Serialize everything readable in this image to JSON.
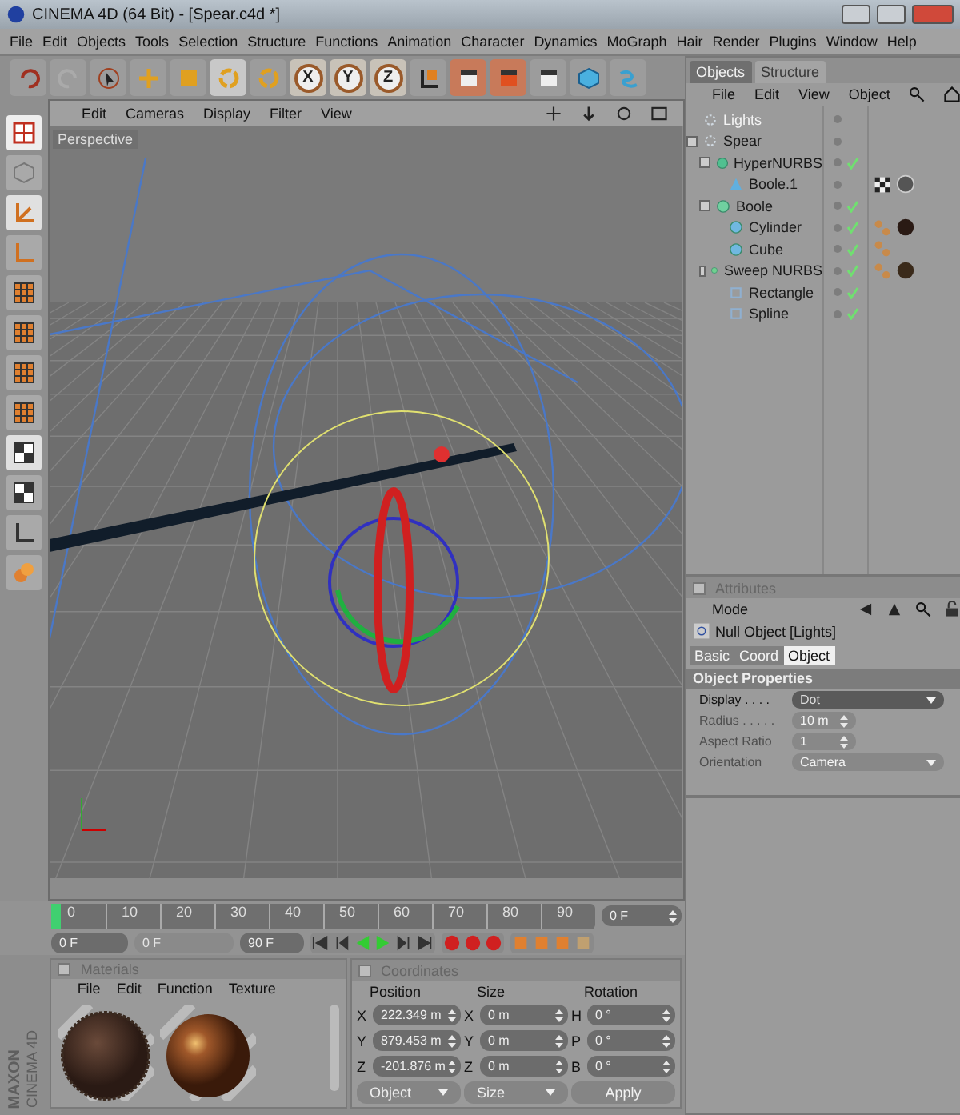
{
  "window": {
    "title": "CINEMA 4D (64 Bit) - [Spear.c4d *]"
  },
  "menu": [
    "File",
    "Edit",
    "Objects",
    "Tools",
    "Selection",
    "Structure",
    "Functions",
    "Animation",
    "Character",
    "Dynamics",
    "MoGraph",
    "Hair",
    "Render",
    "Plugins",
    "Window",
    "Help"
  ],
  "toolbar": {
    "axes": [
      "X",
      "Y",
      "Z"
    ]
  },
  "viewport": {
    "menu": [
      "Edit",
      "Cameras",
      "Display",
      "Filter",
      "View"
    ],
    "camera": "Perspective"
  },
  "timeline": {
    "ticks": [
      "0",
      "10",
      "20",
      "30",
      "40",
      "50",
      "60",
      "70",
      "80",
      "90"
    ],
    "level": 0,
    "current": "0 F",
    "start": "0 F",
    "slider": "0 F",
    "end": "90 F"
  },
  "materials": {
    "title": "Materials",
    "checked": false,
    "menu": [
      "File",
      "Edit",
      "Function",
      "Texture"
    ],
    "items": [
      {
        "kind": "rough"
      },
      {
        "kind": "glossy"
      }
    ]
  },
  "coordinates": {
    "title": "Coordinates",
    "checked": false,
    "headers": [
      "Position",
      "Size",
      "Rotation"
    ],
    "rows": [
      {
        "pos_axis": "X",
        "pos": "222.349 m",
        "size_axis": "X",
        "size": "0 m",
        "rot_axis": "H",
        "rot": "0 °"
      },
      {
        "pos_axis": "Y",
        "pos": "879.453 m",
        "size_axis": "Y",
        "size": "0 m",
        "rot_axis": "P",
        "rot": "0 °"
      },
      {
        "pos_axis": "Z",
        "pos": "-201.876 m",
        "size_axis": "Z",
        "size": "0 m",
        "rot_axis": "B",
        "rot": "0 °"
      }
    ],
    "modes": [
      "Object",
      "Size"
    ],
    "apply": "Apply"
  },
  "objects": {
    "tabs": [
      {
        "label": "Objects",
        "selected": true
      },
      {
        "label": "Structure",
        "selected": false
      }
    ],
    "menu": [
      "File",
      "Edit",
      "View",
      "Object"
    ],
    "tree": [
      {
        "name": "Lights",
        "kind": "null",
        "selected": true,
        "check": false
      },
      {
        "name": "Spear",
        "kind": "null",
        "selected": false,
        "check": false,
        "children": [
          {
            "name": "HyperNURBS",
            "kind": "nurbs",
            "selected": false,
            "check": true,
            "children": [
              {
                "name": "Boole.1",
                "kind": "cone",
                "selected": false,
                "check": false,
                "tags": [
                  {
                    "kind": "checker"
                  },
                  {
                    "kind": "gray-material"
                  }
                ]
              }
            ]
          },
          {
            "name": "Boole",
            "kind": "boole",
            "selected": false,
            "check": true,
            "children": [
              {
                "name": "Cylinder",
                "kind": "cylinder",
                "selected": false,
                "check": true,
                "tags": [
                  {
                    "kind": "phong"
                  },
                  {
                    "kind": "rough-material"
                  }
                ]
              },
              {
                "name": "Cube",
                "kind": "cube",
                "selected": false,
                "check": true,
                "tags": [
                  {
                    "kind": "phong"
                  }
                ]
              }
            ]
          },
          {
            "name": "Sweep NURBS",
            "kind": "sweep",
            "selected": false,
            "check": true,
            "tags": [
              {
                "kind": "phong"
              },
              {
                "kind": "dark-material"
              }
            ],
            "children": [
              {
                "name": "Rectangle",
                "kind": "spline",
                "selected": false,
                "check": true
              },
              {
                "name": "Spline",
                "kind": "spline",
                "selected": false,
                "check": true
              }
            ]
          }
        ]
      }
    ]
  },
  "attributes": {
    "title": "Attributes",
    "checked": false,
    "mode": "Mode",
    "object": "Null Object [Lights]",
    "tabs": [
      {
        "label": "Basic",
        "selected": false
      },
      {
        "label": "Coord",
        "selected": false
      },
      {
        "label": "Object",
        "selected": true
      }
    ],
    "section": "Object Properties",
    "fields": [
      {
        "label": "Display . . . .",
        "value": "Dot",
        "kind": "dropdown",
        "disabled": false
      },
      {
        "label": "Radius . . . . .",
        "value": "10 m",
        "kind": "spinner",
        "disabled": true
      },
      {
        "label": "Aspect Ratio",
        "value": "1",
        "kind": "spinner",
        "disabled": true
      },
      {
        "label": "Orientation",
        "value": "Camera",
        "kind": "dropdown",
        "disabled": true
      }
    ]
  },
  "logo": [
    "MAXON",
    "CINEMA 4D"
  ]
}
